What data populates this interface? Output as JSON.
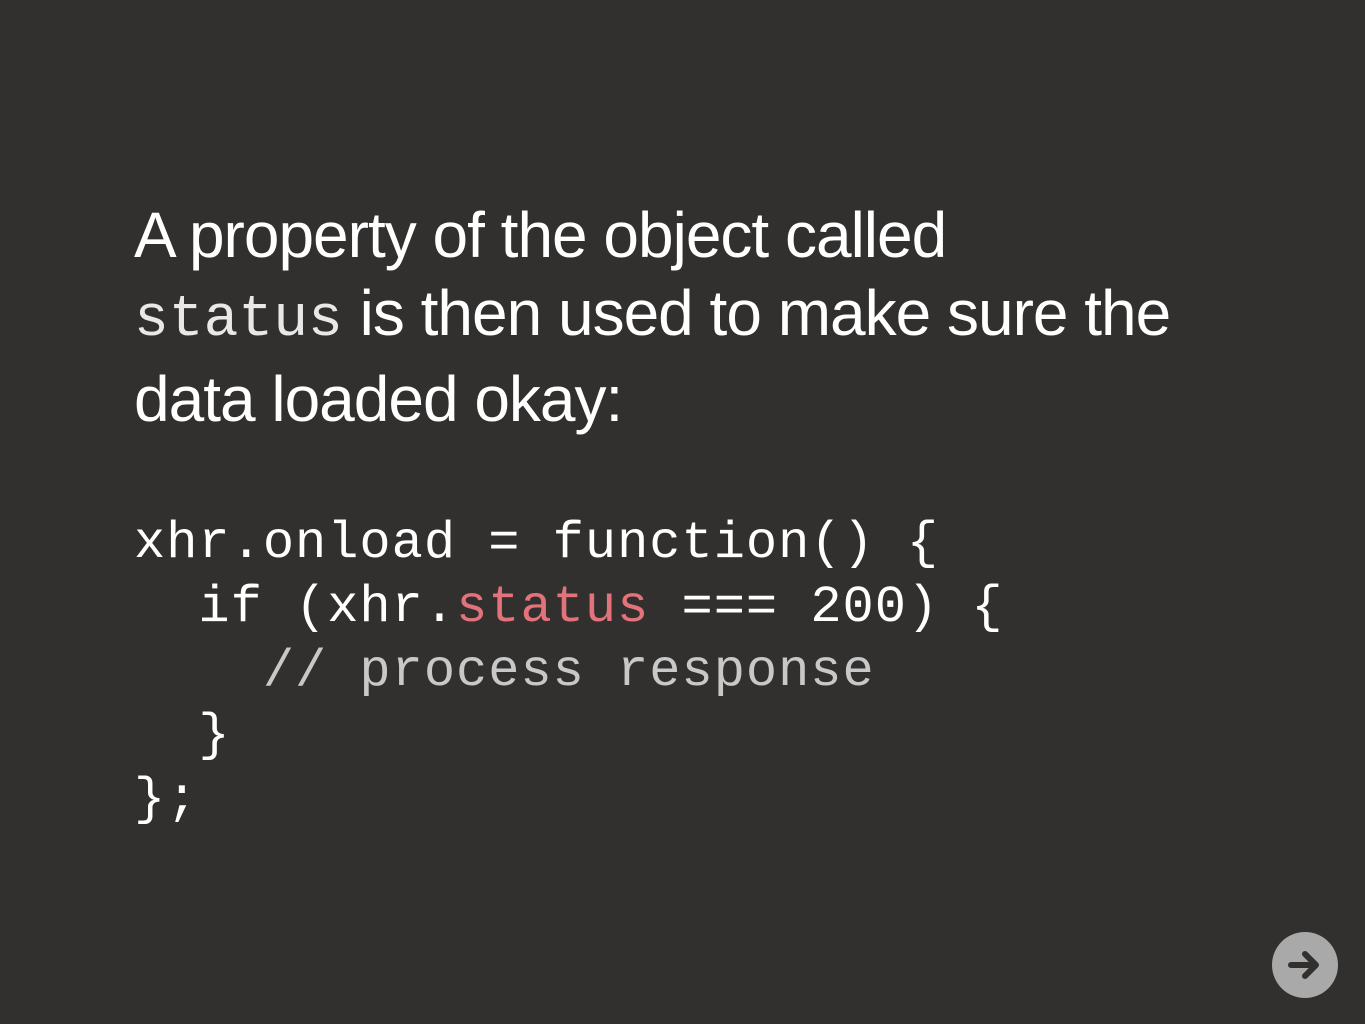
{
  "slide": {
    "heading": {
      "part1": "A property of the object called",
      "code_word": "status",
      "part2": " is then used to make sure the data loaded okay:"
    },
    "code": {
      "line1": "xhr.onload = function() {",
      "line2_prefix": "  if (xhr.",
      "line2_highlight": "status",
      "line2_suffix": " === 200) {",
      "line3": "    // process response",
      "line4": "  }",
      "line5": "};"
    },
    "colors": {
      "background": "#32302f",
      "text": "#ffffff",
      "highlight": "#e3737a",
      "next_button": "#a9a9a9",
      "next_arrow": "#32302f"
    },
    "icons": {
      "next": "arrow-right-icon"
    }
  }
}
